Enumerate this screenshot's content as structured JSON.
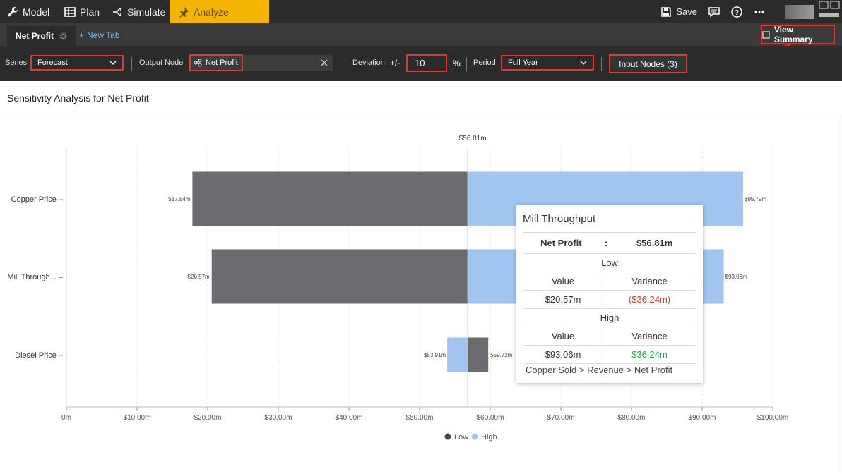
{
  "nav": {
    "model": "Model",
    "plan": "Plan",
    "simulate": "Simulate",
    "analyze": "Analyze",
    "save": "Save"
  },
  "tabs": {
    "active": "Net Profit",
    "new_tab": "New Tab",
    "view_summary": "View Summary"
  },
  "controls": {
    "series_label": "Series",
    "series_value": "Forecast",
    "output_node_label": "Output Node",
    "output_node_value": "Net Profit",
    "deviation_label": "Deviation",
    "plus_minus": "+/-",
    "deviation_value": "10",
    "percent": "%",
    "period_label": "Period",
    "period_value": "Full Year",
    "input_nodes": "Input Nodes (3)"
  },
  "page_title": "Sensitivity Analysis for Net Profit",
  "chart_data": {
    "type": "bar",
    "orientation": "horizontal-tornado",
    "baseline": 56.81,
    "baseline_label": "$56.81m",
    "categories": [
      "Copper Price",
      "Mill Through...",
      "Diesel Price"
    ],
    "series": [
      {
        "name": "Low",
        "values": [
          17.84,
          20.57,
          59.72
        ],
        "labels": [
          "$17.84m",
          "$20.57m",
          "$59.72m"
        ],
        "color": "#6b6b70"
      },
      {
        "name": "High",
        "values": [
          95.79,
          93.06,
          53.91
        ],
        "labels": [
          "$95.79m",
          "$93.06m",
          "$53.91m"
        ],
        "color": "#9fc5f0"
      }
    ],
    "xlim": [
      0,
      100
    ],
    "xticks": [
      "0m",
      "$10.00m",
      "$20.00m",
      "$30.00m",
      "$40.00m",
      "$50.00m",
      "$60.00m",
      "$70.00m",
      "$80.00m",
      "$90.00m",
      "$100.00m"
    ],
    "grid": true,
    "legend": "bottom-center"
  },
  "tooltip": {
    "title": "Mill Throughput",
    "output_name": "Net Profit",
    "colon": ":",
    "output_value": "$56.81m",
    "low_header": "Low",
    "high_header": "High",
    "value_header": "Value",
    "variance_header": "Variance",
    "low_value": "$20.57m",
    "low_variance": "($36.24m)",
    "high_value": "$93.06m",
    "high_variance": "$36.24m",
    "path": "Copper Sold > Revenue > Net Profit"
  },
  "colors": {
    "accent_yellow": "#f4b400",
    "highlight_red": "#e3342f",
    "low_bar": "#6b6b70",
    "high_bar": "#9fc5f0"
  }
}
